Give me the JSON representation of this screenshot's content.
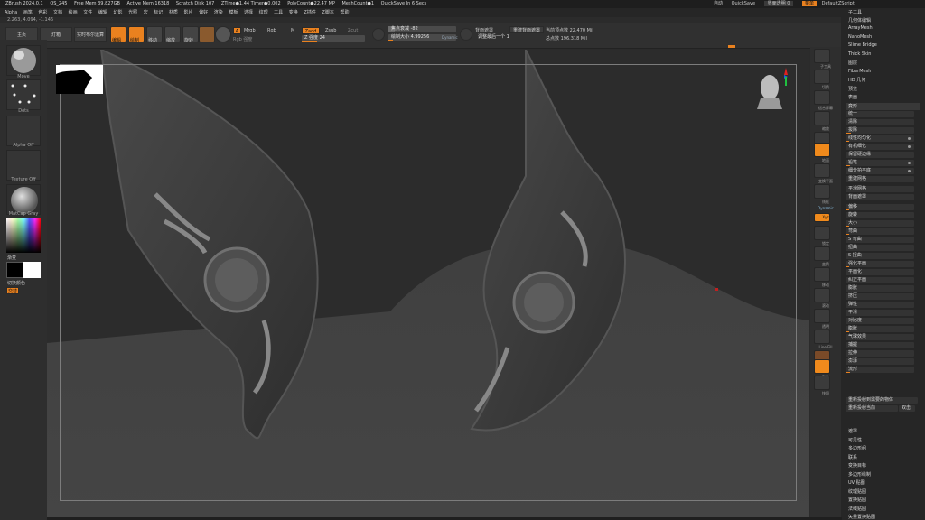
{
  "titlebar": {
    "items": [
      "ZBrush 2024.0.1",
      "QS_245",
      "Free Mem 39.827GB",
      "Active Mem 16318",
      "Scratch Disk 107",
      "ZTime●1.44 Timer●0.002",
      "PolyCount●22.47 MP",
      "MeshCount●1",
      "QuickSave In 6 Secs"
    ],
    "right": [
      "自动",
      "QuickSave",
      "界面透明 0",
      "菜单",
      "DefaultZScript"
    ]
  },
  "menubar": {
    "items": [
      "Alpha",
      "画笔",
      "色彩",
      "文档",
      "绘画",
      "文件",
      "编辑",
      "幻影",
      "光照",
      "宏",
      "标记",
      "材质",
      "影片",
      "偏好",
      "渲染",
      "模板",
      "选择",
      "纹理",
      "工具",
      "变换",
      "Z插件",
      "Z脚本",
      "帮助"
    ]
  },
  "coords": "2.263, 4.094, -1.146",
  "toolbar": {
    "home": "主页",
    "lightbox": "灯箱",
    "livebool": "实时布尔运算",
    "edit": "编辑",
    "draw": "绘制",
    "move": "移动",
    "scale": "缩放",
    "rotate": "旋转",
    "a": "A",
    "mrgb": "Mrgb",
    "rgb": "Rgb",
    "m": "M",
    "rgb_intensity": "Rgb 强度",
    "zadd": "Zadd",
    "zsub": "Zsub",
    "zcut": "Zcut",
    "z_intensity": "Z 强度 24",
    "focal_shift": "焦点衰减 -82",
    "draw_size": "绘制大小 4.99256",
    "dynamic": "Dynamic",
    "backface": "背面遮罩",
    "adjust_next": "调整最后一个 1",
    "active_points_btn": "重建背面遮罩",
    "active_points": "当前顶点数 22.470 Mil",
    "total_points": "总点数 196.318 Mil"
  },
  "lefttray": {
    "brush": "Move",
    "stroke": "Dots",
    "alpha": "Alpha Off",
    "texture": "Texture Off",
    "material": "MatCap Gray",
    "gradient": "渐变",
    "switch": "切换颜色",
    "alternate": "交替"
  },
  "righttray": [
    "子工具",
    "切换",
    "适合屏幕",
    "缩放",
    "透视",
    "地面",
    "变换平面",
    "线框",
    "Dynamic",
    "Xyz",
    "锁定",
    "变换",
    "移动",
    "滚动",
    "透明",
    "Line Fill",
    "透明",
    "默认",
    "快照"
  ],
  "panel": {
    "top_items": [
      "子工具",
      "几何体编辑",
      "ArrayMesh",
      "NanoMesh",
      "Slime Bridge",
      "Thick Skin",
      "图层",
      "FiberMesh",
      "HD 几何",
      "预览",
      "表面"
    ],
    "section": "变形",
    "rows": [
      "统一",
      "清除",
      "拔除",
      "线性均匀化",
      "有机细化",
      "保留硬边缘",
      "铅笔",
      "细分拍平底",
      "重建网格",
      "平滑网格",
      "背面遮罩",
      "偏移",
      "旋转",
      "大小",
      "弯曲",
      "S 弯曲",
      "扭曲",
      "S 扭曲",
      "强化平面",
      "平面化",
      "纠正平面",
      "膨胀",
      "挤压",
      "弹性",
      "平滑",
      "对比度",
      "膨胀",
      "气球效果",
      "捕握",
      "拉伸",
      "澎湃",
      "流形"
    ],
    "special": [
      "重新投射到需要的物体",
      "重新投射当前",
      "双击"
    ],
    "bottom_items": [
      "遮罩",
      "可见性",
      "多边形组",
      "联系",
      "变换目标",
      "多边形绘制",
      "UV 贴图",
      "纹理贴图",
      "置换贴图",
      "法线贴图",
      "矢量置换贴图"
    ]
  },
  "colors": {
    "accent": "#e9811f",
    "bg": "#2b2b2b",
    "mesh": "#3c3c3c"
  }
}
